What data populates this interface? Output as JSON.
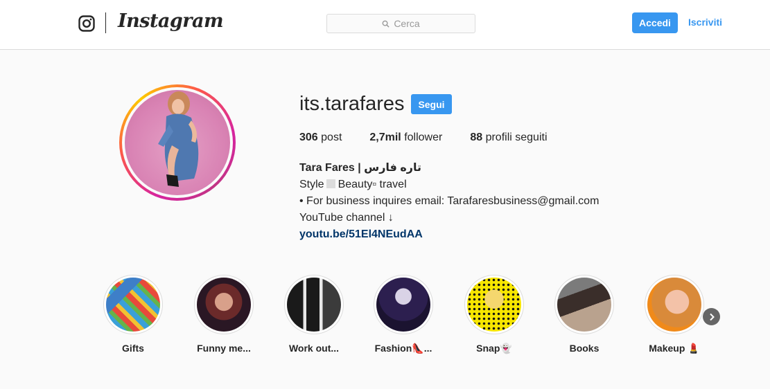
{
  "header": {
    "wordmark": "Instagram",
    "search_placeholder": "Cerca",
    "login_label": "Accedi",
    "signup_label": "Iscriviti"
  },
  "profile": {
    "username": "its.tarafares",
    "follow_label": "Segui",
    "stats": {
      "posts_count": "306",
      "posts_label": " post",
      "followers_count": "2,7mil",
      "followers_label": " follower",
      "following_count": "88",
      "following_label": " profili seguiti"
    },
    "bio": {
      "name": "Tara Fares | تاره فارس",
      "line1_a": "Style",
      "line1_b": "Beauty▫ travel",
      "line2": "• For business inquires email: Tarafaresbusiness@gmail.com",
      "line3": "YouTube channel ↓",
      "link": "youtu.be/51El4NEudAA"
    }
  },
  "highlights": [
    {
      "label": "Gifts"
    },
    {
      "label": "Funny me..."
    },
    {
      "label": "Work out..."
    },
    {
      "label": "Fashion👠..."
    },
    {
      "label": "Snap👻"
    },
    {
      "label": "Books"
    },
    {
      "label": "Makeup 💄"
    }
  ],
  "colors": {
    "accent": "#3897f0",
    "link": "#003569",
    "border": "#dbdbdb"
  }
}
